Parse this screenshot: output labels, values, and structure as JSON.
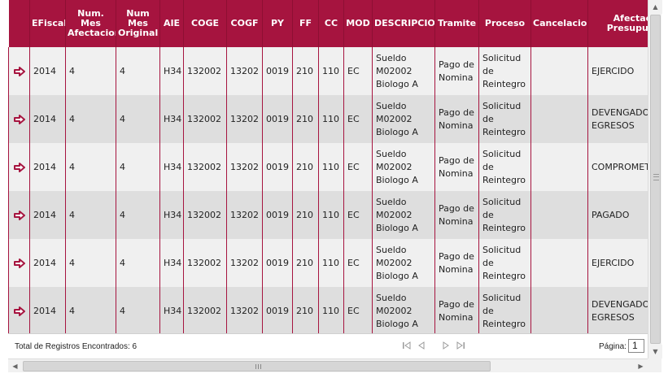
{
  "grid": {
    "columns": [
      "",
      "EFiscal",
      "Num. Mes Afectacion",
      "Num Mes Original",
      "AIE",
      "COGE",
      "COGF",
      "PY",
      "FF",
      "CC",
      "MOD",
      "DESCRIPCION",
      "Tramite",
      "Proceso",
      "Cancelacion",
      "Afectacion Presupuestal"
    ],
    "rows": [
      {
        "efiscal": "2014",
        "mes_afectacion": "4",
        "mes_original": "4",
        "aie": "H34",
        "coge": "132002",
        "cogf": "13202",
        "py": "0019",
        "ff": "210",
        "cc": "110",
        "mod": "EC",
        "descripcion": "Sueldo M02002 Biologo A",
        "tramite": "Pago de Nomina",
        "proceso": "Solicitud de Reintegro",
        "cancelacion": "",
        "afectacion": "EJERCIDO"
      },
      {
        "efiscal": "2014",
        "mes_afectacion": "4",
        "mes_original": "4",
        "aie": "H34",
        "coge": "132002",
        "cogf": "13202",
        "py": "0019",
        "ff": "210",
        "cc": "110",
        "mod": "EC",
        "descripcion": "Sueldo M02002 Biologo A",
        "tramite": "Pago de Nomina",
        "proceso": "Solicitud de Reintegro",
        "cancelacion": "",
        "afectacion": "DEVENGADO EGRESOS"
      },
      {
        "efiscal": "2014",
        "mes_afectacion": "4",
        "mes_original": "4",
        "aie": "H34",
        "coge": "132002",
        "cogf": "13202",
        "py": "0019",
        "ff": "210",
        "cc": "110",
        "mod": "EC",
        "descripcion": "Sueldo M02002 Biologo A",
        "tramite": "Pago de Nomina",
        "proceso": "Solicitud de Reintegro",
        "cancelacion": "",
        "afectacion": "COMPROMETIDO"
      },
      {
        "efiscal": "2014",
        "mes_afectacion": "4",
        "mes_original": "4",
        "aie": "H34",
        "coge": "132002",
        "cogf": "13202",
        "py": "0019",
        "ff": "210",
        "cc": "110",
        "mod": "EC",
        "descripcion": "Sueldo M02002 Biologo A",
        "tramite": "Pago de Nomina",
        "proceso": "Solicitud de Reintegro",
        "cancelacion": "",
        "afectacion": "PAGADO"
      },
      {
        "efiscal": "2014",
        "mes_afectacion": "4",
        "mes_original": "4",
        "aie": "H34",
        "coge": "132002",
        "cogf": "13202",
        "py": "0019",
        "ff": "210",
        "cc": "110",
        "mod": "EC",
        "descripcion": "Sueldo M02002 Biologo A",
        "tramite": "Pago de Nomina",
        "proceso": "Solicitud de Reintegro",
        "cancelacion": "",
        "afectacion": "EJERCIDO"
      },
      {
        "efiscal": "2014",
        "mes_afectacion": "4",
        "mes_original": "4",
        "aie": "H34",
        "coge": "132002",
        "cogf": "13202",
        "py": "0019",
        "ff": "210",
        "cc": "110",
        "mod": "EC",
        "descripcion": "Sueldo M02002 Biologo A",
        "tramite": "Pago de Nomina",
        "proceso": "Solicitud de Reintegro",
        "cancelacion": "",
        "afectacion": "DEVENGADO EGRESOS"
      }
    ]
  },
  "footer": {
    "total_label": "Total de Registros Encontrados: 6",
    "pagina_label": "Página:",
    "page_value": "1"
  },
  "icons": {
    "row_action": "arrow-right-icon",
    "pager": [
      "first-page-icon",
      "prev-page-icon",
      "next-page-icon",
      "last-page-icon"
    ]
  },
  "colors": {
    "header_bg": "#a6143f",
    "header_text": "#ffffff",
    "row_odd": "#f0f0f0",
    "row_even": "#dedede",
    "grid_line": "#a6143f",
    "arrow": "#a6143f"
  }
}
